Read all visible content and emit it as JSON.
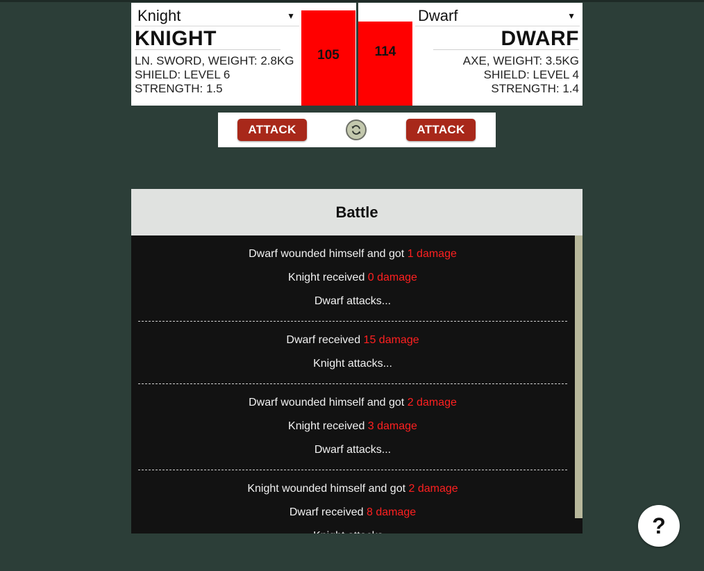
{
  "left": {
    "select_value": "Knight",
    "name": "KNIGHT",
    "weapon": "Ln. Sword, weight: 2.8kg",
    "shield": "Shield: level 6",
    "strength": "Strength: 1.5",
    "hp": 105,
    "hp_fraction": 0.96
  },
  "right": {
    "select_value": "Dwarf",
    "name": "DWARF",
    "weapon": "Axe, weight: 3.5kg",
    "shield": "Shield: level 4",
    "strength": "Strength: 1.4",
    "hp": 114,
    "hp_fraction": 0.82
  },
  "controls": {
    "attack_left_label": "ATTACK",
    "attack_right_label": "ATTACK",
    "reset_icon": "refresh-icon"
  },
  "battle": {
    "title": "Battle",
    "log": [
      [
        {
          "text": "Dwarf wounded himself and got ",
          "dmg": "1 damage"
        },
        {
          "text": "Knight received ",
          "dmg": "0 damage"
        },
        {
          "text": "Dwarf attacks...",
          "dmg": ""
        }
      ],
      [
        {
          "text": "Dwarf received ",
          "dmg": "15 damage"
        },
        {
          "text": "Knight attacks...",
          "dmg": ""
        }
      ],
      [
        {
          "text": "Dwarf wounded himself and got ",
          "dmg": "2 damage"
        },
        {
          "text": "Knight received ",
          "dmg": "3 damage"
        },
        {
          "text": "Dwarf attacks...",
          "dmg": ""
        }
      ],
      [
        {
          "text": "Knight wounded himself and got ",
          "dmg": "2 damage"
        },
        {
          "text": "Dwarf received ",
          "dmg": "8 damage"
        },
        {
          "text": "Knight attacks...",
          "dmg": ""
        }
      ]
    ]
  },
  "help_label": "?",
  "colors": {
    "background": "#2c3e38",
    "hp_bar": "#ff0000",
    "attack_button": "#a8281a",
    "damage_text": "#ff2020"
  }
}
